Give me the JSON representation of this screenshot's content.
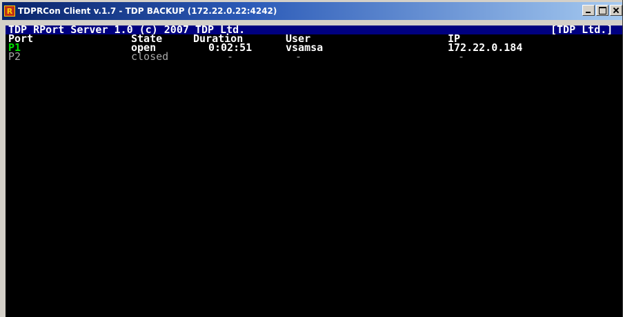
{
  "window": {
    "title": "TDPRCon Client v.1.7 - TDP BACKUP (172.22.0.22:4242)",
    "icon": "tdp-app-icon",
    "icon_glyph": "R"
  },
  "console": {
    "header_left": "TDP RPort Server 1.0 (c) 2007 TDP Ltd.",
    "header_right": "[TDP Ltd.]",
    "columns": [
      "Port",
      "State",
      "Duration",
      "User",
      "IP"
    ],
    "rows": [
      {
        "port": "P1",
        "state": "open",
        "duration": "0:02:51",
        "user": "vsamsa",
        "ip": "172.22.0.184"
      },
      {
        "port": "P2",
        "state": "closed",
        "duration": "-",
        "user": "-",
        "ip": "-"
      }
    ]
  },
  "colors": {
    "console_bg": "#000000",
    "header_bg": "#000080",
    "active_port": "#00e000",
    "inactive_text": "#a8a8a8",
    "text": "#ffffff"
  }
}
